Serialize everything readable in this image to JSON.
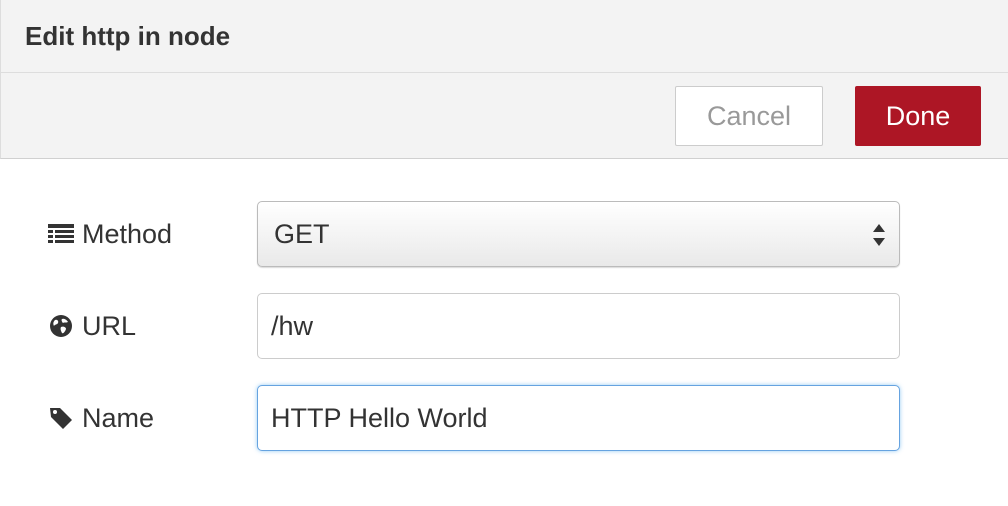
{
  "dialog": {
    "title": "Edit http in node"
  },
  "toolbar": {
    "cancel_label": "Cancel",
    "done_label": "Done"
  },
  "form": {
    "method": {
      "label": "Method",
      "icon": "list-icon",
      "value": "GET"
    },
    "url": {
      "label": "URL",
      "icon": "globe-icon",
      "value": "/hw"
    },
    "name": {
      "label": "Name",
      "icon": "tag-icon",
      "value": "HTTP Hello World"
    }
  },
  "colors": {
    "done_button": "#ad1625",
    "header_background": "#f3f3f3",
    "focus_border": "#66a3e0"
  }
}
